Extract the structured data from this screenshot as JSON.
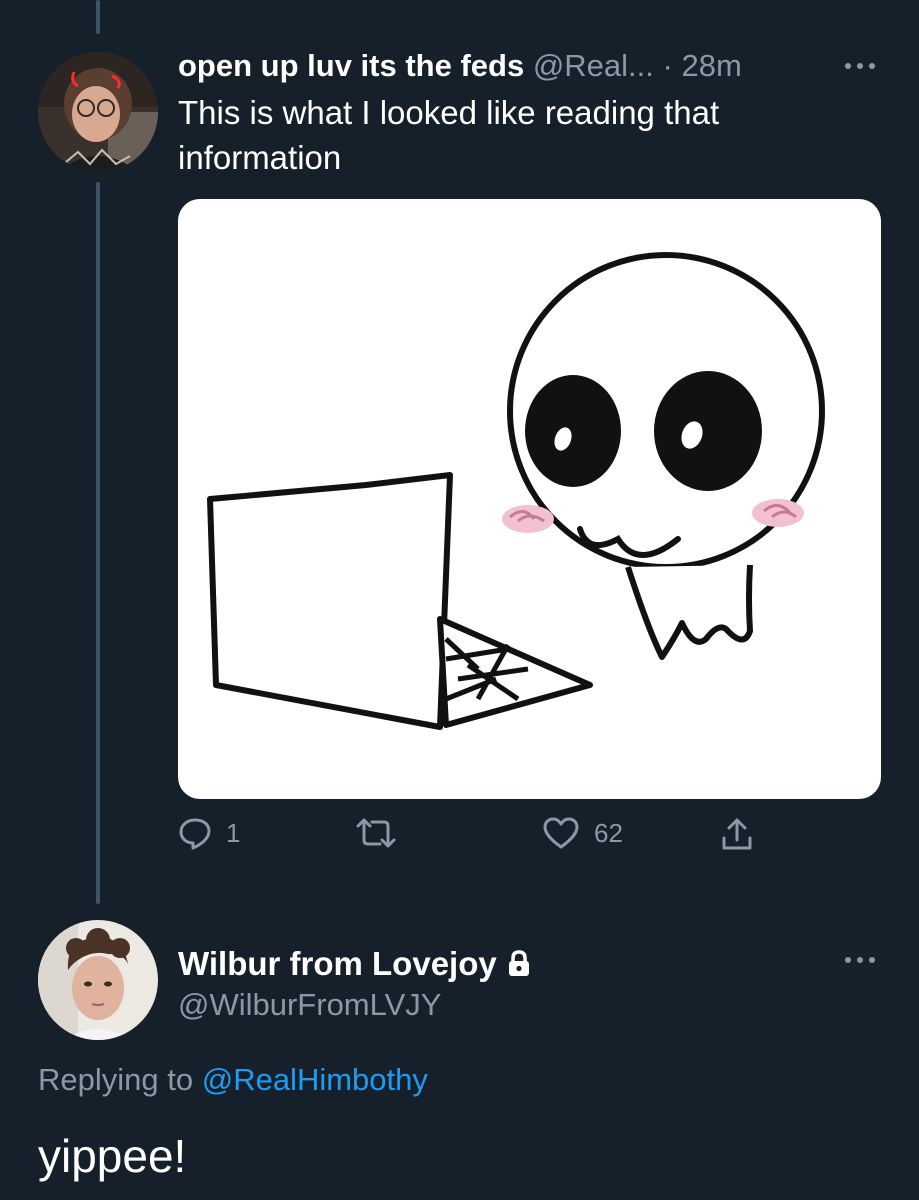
{
  "colors": {
    "background": "#15202b",
    "secondary_text": "#8b98a5",
    "link": "#1d9bf0",
    "thread_line": "#3d5466"
  },
  "tweet1": {
    "display_name": "open up luv its the feds",
    "handle": "@Real...",
    "separator": "·",
    "timestamp": "28m",
    "text": "This is what I looked like reading that information",
    "avatar_icon": "user-avatar",
    "media_icon": "cartoon-at-laptop-image",
    "actions": {
      "reply_count": "1",
      "retweet_count": "",
      "like_count": "62"
    }
  },
  "tweet2": {
    "display_name": "Wilbur from Lovejoy",
    "handle": "@WilburFromLVJY",
    "locked_icon": "lock-icon",
    "replying_prefix": "Replying to",
    "replying_to": "@RealHimbothy",
    "text": "yippee!",
    "avatar_icon": "user-avatar"
  }
}
